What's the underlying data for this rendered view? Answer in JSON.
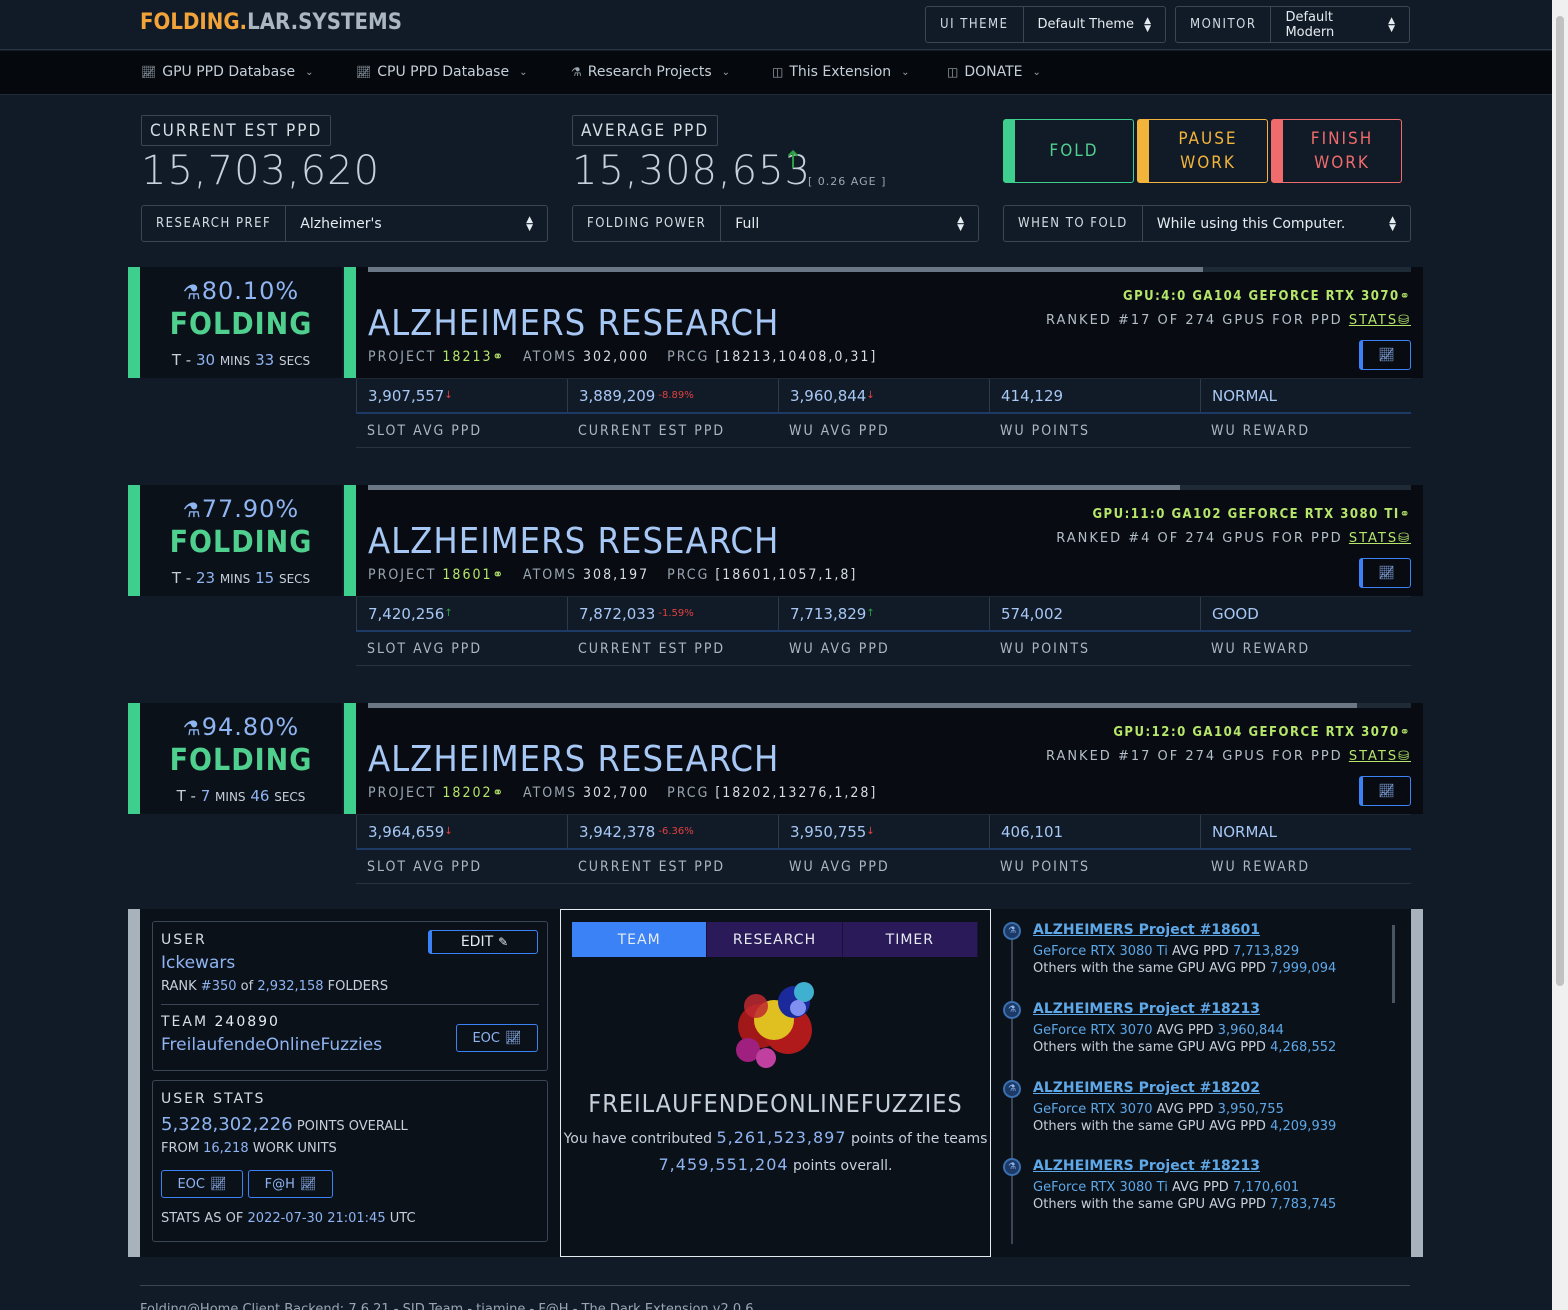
{
  "brand": {
    "part1": "FOLDING.",
    "part2": "LAR.SYSTEMS"
  },
  "header": {
    "ui_theme_label": "UI THEME",
    "ui_theme_value": "Default Theme",
    "monitor_label": "MONITOR",
    "monitor_value": "Default Modern"
  },
  "nav": [
    {
      "label": "GPU PPD Database",
      "icon": "chart-icon"
    },
    {
      "label": "CPU PPD Database",
      "icon": "chart-icon"
    },
    {
      "label": "Research Projects",
      "icon": "flask-icon"
    },
    {
      "label": "This Extension",
      "icon": "window-icon"
    },
    {
      "label": "DONATE",
      "icon": "window-icon"
    }
  ],
  "summary": {
    "current_label": "CURRENT EST PPD",
    "current_value": "15,703,620",
    "average_label": "AVERAGE PPD",
    "average_value": "15,308,653",
    "age": "[ 0.26 AGE ]"
  },
  "actions": {
    "fold": "FOLD",
    "pause_line1": "PAUSE",
    "pause_line2": "WORK",
    "finish_line1": "FINISH",
    "finish_line2": "WORK"
  },
  "prefs": {
    "research_label": "RESEARCH PREF",
    "research_value": "Alzheimer's",
    "power_label": "FOLDING POWER",
    "power_value": "Full",
    "when_label": "WHEN TO FOLD",
    "when_value": "While using this Computer."
  },
  "slots": [
    {
      "pct": "80.10%",
      "progress": 0.801,
      "status": "FOLDING",
      "eta_prefix": "T - ",
      "eta_mins": "30",
      "eta_secs": "33",
      "title": "ALZHEIMERS RESEARCH",
      "project": "18213",
      "atoms": "302,000",
      "prcg": "[18213,10408,0,31]",
      "gpu": "GPU:4:0 GA104 GEFORCE RTX 3070",
      "rank": "RANKED #17 OF 274 GPUS FOR PPD",
      "slot_avg": "3,907,557",
      "slot_avg_dir": "down",
      "cur_est": "3,889,209",
      "cur_est_chg": "-8.89%",
      "wu_avg": "3,960,844",
      "wu_avg_dir": "down",
      "wu_points": "414,129",
      "wu_reward": "NORMAL"
    },
    {
      "pct": "77.90%",
      "progress": 0.779,
      "status": "FOLDING",
      "eta_prefix": "T - ",
      "eta_mins": "23",
      "eta_secs": "15",
      "title": "ALZHEIMERS RESEARCH",
      "project": "18601",
      "atoms": "308,197",
      "prcg": "[18601,1057,1,8]",
      "gpu": "GPU:11:0 GA102 GEFORCE RTX 3080 TI",
      "rank": "RANKED #4 OF 274 GPUS FOR PPD",
      "slot_avg": "7,420,256",
      "slot_avg_dir": "up",
      "cur_est": "7,872,033",
      "cur_est_chg": "-1.59%",
      "wu_avg": "7,713,829",
      "wu_avg_dir": "up",
      "wu_points": "574,002",
      "wu_reward": "GOOD"
    },
    {
      "pct": "94.80%",
      "progress": 0.948,
      "status": "FOLDING",
      "eta_prefix": "T - ",
      "eta_mins": "7",
      "eta_secs": "46",
      "title": "ALZHEIMERS RESEARCH",
      "project": "18202",
      "atoms": "302,700",
      "prcg": "[18202,13276,1,28]",
      "gpu": "GPU:12:0 GA104 GEFORCE RTX 3070",
      "rank": "RANKED #17 OF 274 GPUS FOR PPD",
      "slot_avg": "3,964,659",
      "slot_avg_dir": "down",
      "cur_est": "3,942,378",
      "cur_est_chg": "-6.36%",
      "wu_avg": "3,950,755",
      "wu_avg_dir": "down",
      "wu_points": "406,101",
      "wu_reward": "NORMAL"
    }
  ],
  "slot_labels": {
    "project": "PROJECT",
    "atoms": "ATOMS",
    "prcg": "PRCG",
    "stats": "STATS",
    "mins": "MINS",
    "secs": "SECS",
    "heads": [
      "SLOT AVG PPD",
      "CURRENT EST PPD",
      "WU AVG PPD",
      "WU POINTS",
      "WU REWARD"
    ]
  },
  "user": {
    "label": "USER",
    "edit": "EDIT",
    "name": "Ickewars",
    "rank_prefix": "RANK",
    "rank": "#350",
    "of": "of",
    "folders": "2,932,158",
    "folders_label": "FOLDERS",
    "team_label": "TEAM",
    "team_id": "240890",
    "team_name": "FreilaufendeOnlineFuzzies",
    "eoc": "EOC"
  },
  "user_stats": {
    "label": "USER STATS",
    "points": "5,328,302,226",
    "points_label": "POINTS OVERALL",
    "from": "FROM",
    "wus": "16,218",
    "wus_label": "WORK UNITS",
    "eoc": "EOC",
    "fah": "F@H",
    "asof_label": "STATS AS OF",
    "asof": "2022-07-30 21:01:45",
    "utc": "UTC"
  },
  "team_panel": {
    "tabs": [
      "TEAM",
      "RESEARCH",
      "TIMER"
    ],
    "team_name": "FREILAUFENDEONLINEFUZZIES",
    "contrib_prefix": "You have contributed",
    "contrib": "5,261,523,897",
    "contrib_suffix": "points of the teams",
    "overall": "7,459,551,204",
    "overall_suffix": "points overall."
  },
  "feed": [
    {
      "title": "ALZHEIMERS Project #18601",
      "gpu": "GeForce RTX 3080 Ti",
      "avg": "7,713,829",
      "others": "7,999,094"
    },
    {
      "title": "ALZHEIMERS Project #18213",
      "gpu": "GeForce RTX 3070",
      "avg": "3,960,844",
      "others": "4,268,552"
    },
    {
      "title": "ALZHEIMERS Project #18202",
      "gpu": "GeForce RTX 3070",
      "avg": "3,950,755",
      "others": "4,209,939"
    },
    {
      "title": "ALZHEIMERS Project #18213",
      "gpu": "GeForce RTX 3080 Ti",
      "avg": "7,170,601",
      "others": "7,783,745"
    }
  ],
  "feed_labels": {
    "avg": "AVG PPD",
    "others": "Others with the same GPU AVG PPD"
  },
  "footer": "Folding@Home Client Backend: 7.6.21 - SID Team - tiamine - F@H - The Dark Extension v2.0.6",
  "colors": {
    "accent": "#3b82f6",
    "fold": "#3ecf8e",
    "pause": "#f2b43a",
    "finish": "#f06b6b",
    "lime": "#b6e66a"
  }
}
